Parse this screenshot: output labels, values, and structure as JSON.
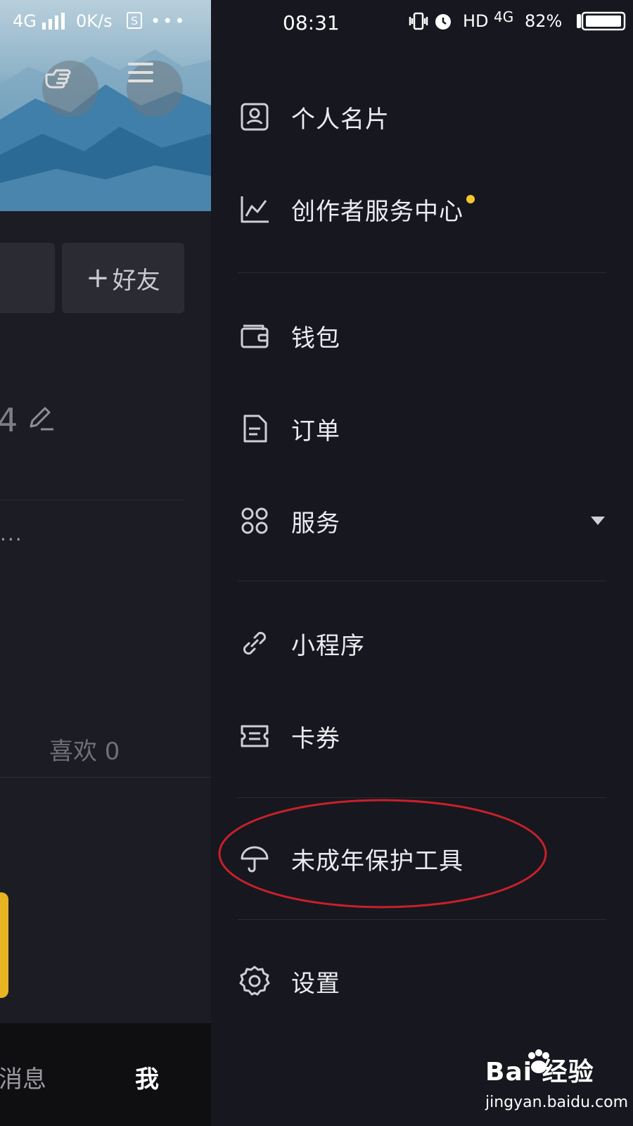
{
  "status_bar": {
    "network_left": "4G",
    "speed": "0K/s",
    "time": "08:31",
    "hd": "HD",
    "network_right": "4G",
    "battery": "82%"
  },
  "background_page": {
    "add_friend_label": "好友",
    "stat_number": "4",
    "ellipsis": "...",
    "likes_label": "喜欢 0",
    "tab_messages": "消息",
    "tab_me": "我"
  },
  "drawer": {
    "items": [
      {
        "label": "个人名片",
        "icon": "contact-card-icon"
      },
      {
        "label": "创作者服务中心",
        "icon": "line-chart-icon",
        "has_dot": true
      },
      {
        "label": "钱包",
        "icon": "wallet-icon"
      },
      {
        "label": "订单",
        "icon": "document-icon"
      },
      {
        "label": "服务",
        "icon": "grid-icon",
        "expandable": true
      },
      {
        "label": "小程序",
        "icon": "link-icon"
      },
      {
        "label": "卡券",
        "icon": "ticket-icon"
      },
      {
        "label": "未成年保护工具",
        "icon": "umbrella-icon",
        "highlighted": true
      },
      {
        "label": "设置",
        "icon": "gear-icon"
      }
    ]
  },
  "colors": {
    "background": "#16171f",
    "notification_dot": "#f4c92b",
    "highlight_ring": "#c8202a"
  },
  "watermark": {
    "logo_text": "Bai  经验",
    "url": "jingyan.baidu.com"
  }
}
